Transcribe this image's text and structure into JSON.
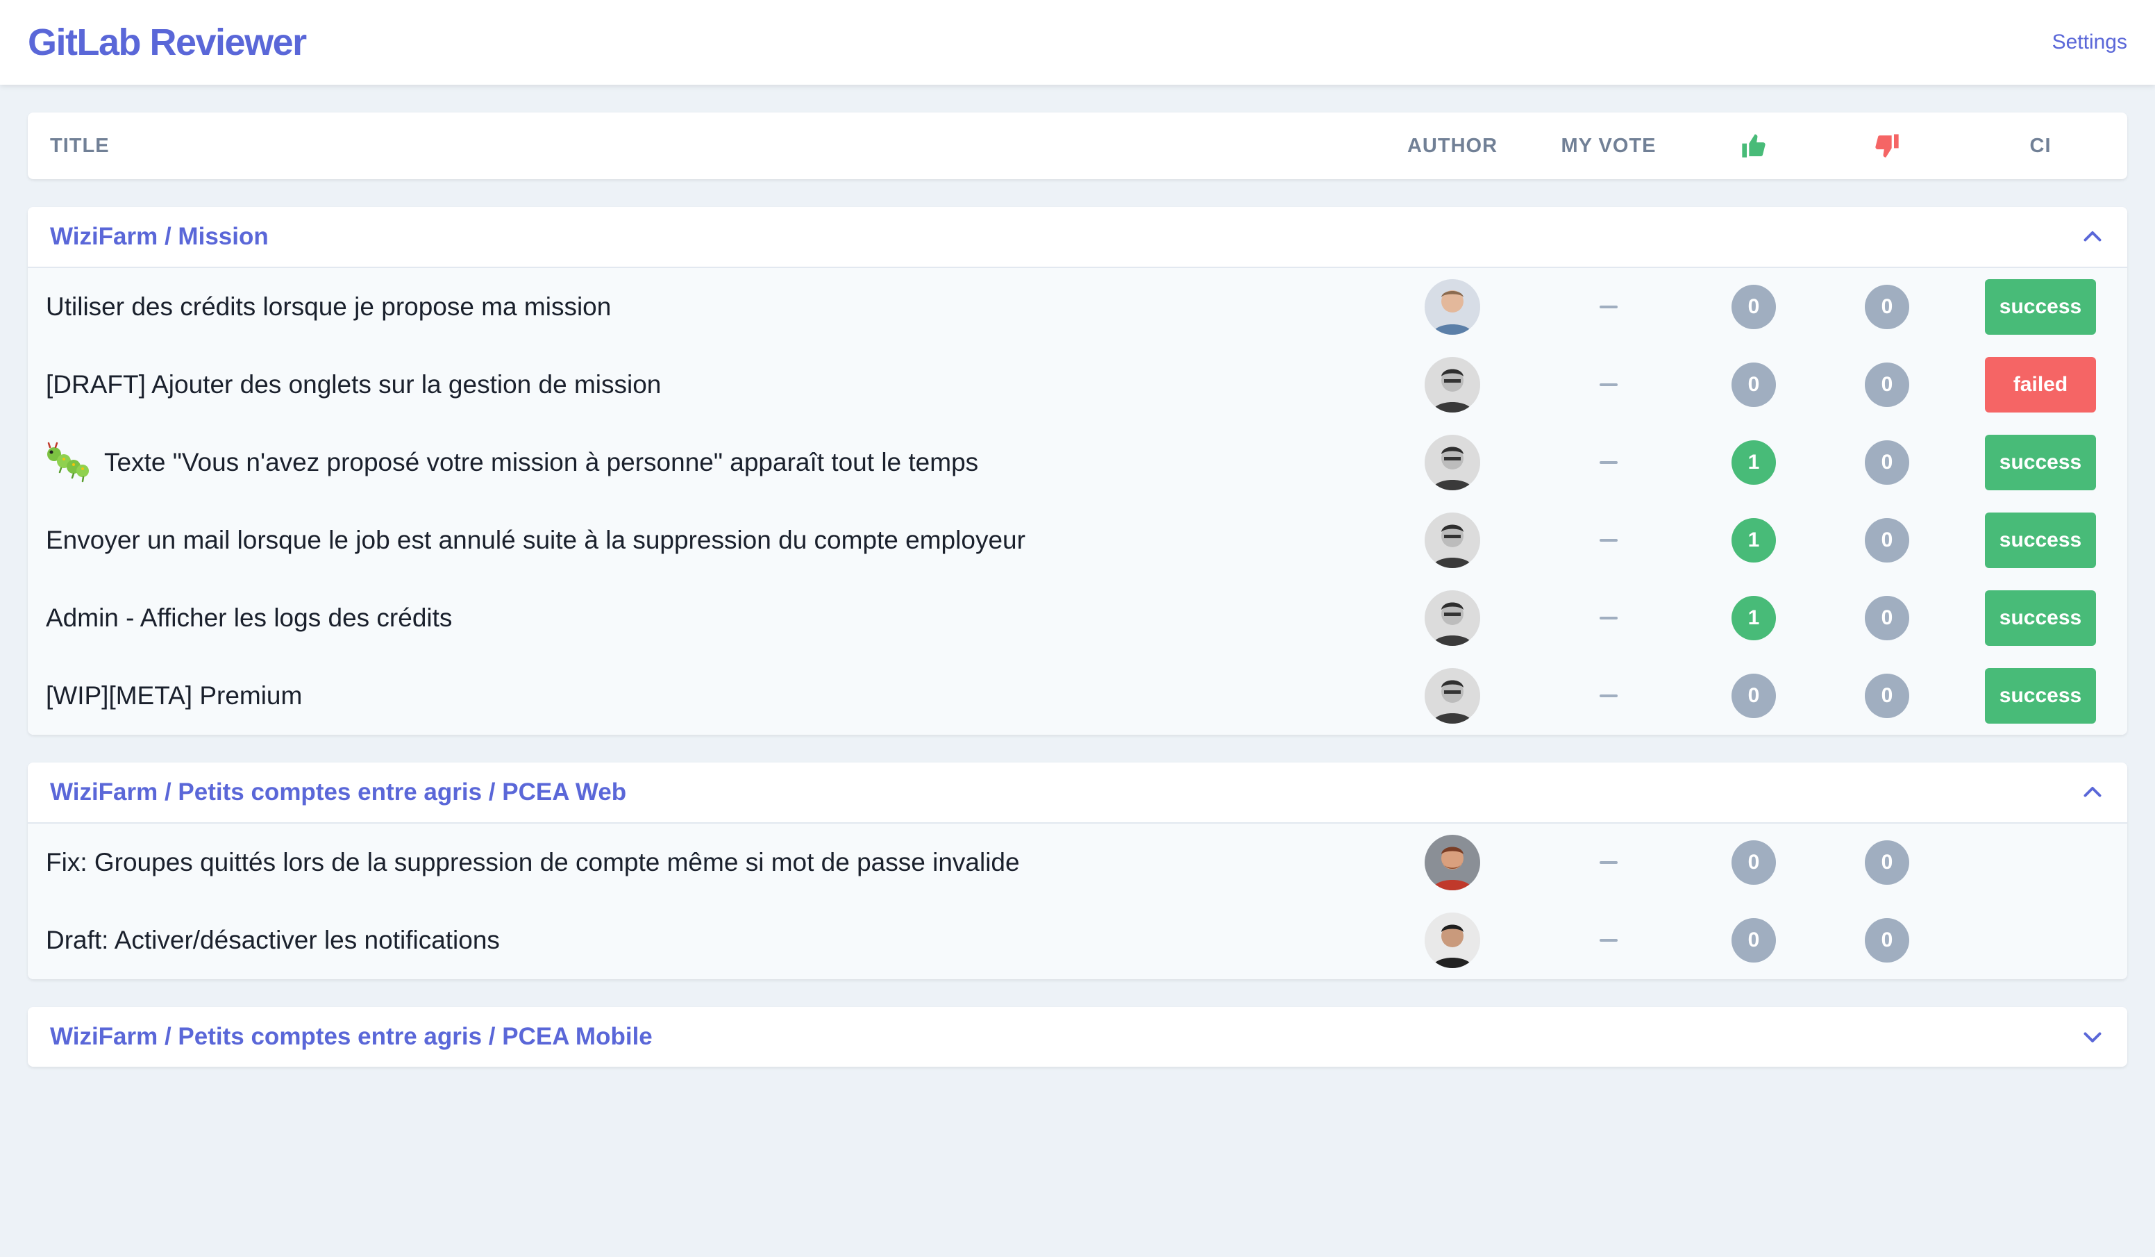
{
  "app": {
    "title": "GitLab Reviewer",
    "settings_label": "Settings"
  },
  "columns": {
    "title": "TITLE",
    "author": "AUTHOR",
    "my_vote": "MY VOTE",
    "ci": "CI"
  },
  "colors": {
    "accent": "#5a67d8",
    "success": "#48bb78",
    "failed": "#f56565",
    "muted": "#a0aec0"
  },
  "icons": {
    "upvote": "thumbs-up-icon",
    "downvote": "thumbs-down-icon",
    "expand": "chevron-down-icon",
    "collapse": "chevron-up-icon"
  },
  "groups": [
    {
      "name": "WiziFarm / Mission",
      "expanded": true,
      "mrs": [
        {
          "title": "Utiliser des crédits lorsque je propose ma mission",
          "icon": "",
          "author_avatar": "avatar-1",
          "my_vote": "—",
          "upvotes": "0",
          "downvotes": "0",
          "ci": "success"
        },
        {
          "title": "[DRAFT] Ajouter des onglets sur la gestion de mission",
          "icon": "",
          "author_avatar": "avatar-2",
          "my_vote": "—",
          "upvotes": "0",
          "downvotes": "0",
          "ci": "failed"
        },
        {
          "title": "Texte \"Vous n'avez proposé votre mission à personne\" apparaît tout le temps",
          "icon": "bug-icon",
          "author_avatar": "avatar-2",
          "my_vote": "—",
          "upvotes": "1",
          "downvotes": "0",
          "ci": "success"
        },
        {
          "title": "Envoyer un mail lorsque le job est annulé suite à la suppression du compte employeur",
          "icon": "",
          "author_avatar": "avatar-2",
          "my_vote": "—",
          "upvotes": "1",
          "downvotes": "0",
          "ci": "success"
        },
        {
          "title": "Admin - Afficher les logs des crédits",
          "icon": "",
          "author_avatar": "avatar-2",
          "my_vote": "—",
          "upvotes": "1",
          "downvotes": "0",
          "ci": "success"
        },
        {
          "title": "[WIP][META] Premium",
          "icon": "",
          "author_avatar": "avatar-2",
          "my_vote": "—",
          "upvotes": "0",
          "downvotes": "0",
          "ci": "success"
        }
      ]
    },
    {
      "name": "WiziFarm / Petits comptes entre agris / PCEA Web",
      "expanded": true,
      "mrs": [
        {
          "title": "Fix: Groupes quittés lors de la suppression de compte même si mot de passe invalide",
          "icon": "",
          "author_avatar": "avatar-3",
          "my_vote": "—",
          "upvotes": "0",
          "downvotes": "0",
          "ci": ""
        },
        {
          "title": "Draft: Activer/désactiver les notifications",
          "icon": "",
          "author_avatar": "avatar-4",
          "my_vote": "—",
          "upvotes": "0",
          "downvotes": "0",
          "ci": ""
        }
      ]
    },
    {
      "name": "WiziFarm / Petits comptes entre agris / PCEA Mobile",
      "expanded": false,
      "mrs": []
    }
  ]
}
